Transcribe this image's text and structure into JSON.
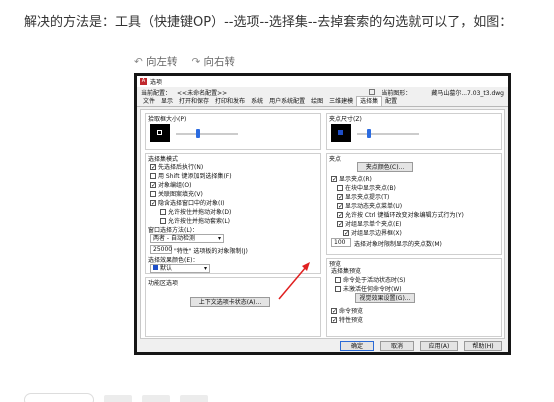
{
  "intro_text": "解决的方法是：工具（快捷键OP）--选项--选择集--去掉套索的勾选就可以了，如图：",
  "toolbar": {
    "rotate_left": "向左转",
    "rotate_right": "向右转"
  },
  "dialog": {
    "title": "选项",
    "profile_label": "当前配置：",
    "profile_value": "<<未命名配置>>",
    "drawing_label": "当前图形：",
    "drawing_value": "藏马山墓尔...7.03_t3.dwg",
    "tabs": [
      "文件",
      "显示",
      "打开和保存",
      "打印和发布",
      "系统",
      "用户系统配置",
      "绘图",
      "三维建模",
      "选择集",
      "配置"
    ],
    "active_tab": "选择集",
    "left": {
      "pickbox_label": "拾取框大小(P)",
      "mode_label": "选择集模式",
      "options": [
        {
          "label": "先选择后执行(N)",
          "checked": true
        },
        {
          "label": "用 Shift 键添加到选择集(F)",
          "checked": false
        },
        {
          "label": "对象编组(O)",
          "checked": true
        },
        {
          "label": "关联图案填充(V)",
          "checked": false
        },
        {
          "label": "隐含选择窗口中的对象(I)",
          "checked": true
        },
        {
          "label": "允许按住并拖动对象(D)",
          "checked": false
        },
        {
          "label": "允许按住并拖动套索(L)",
          "checked": false
        }
      ],
      "window_method_label": "窗口选择方法(L)：",
      "window_method_value": "两者 - 自动检测",
      "limit_value": "25000",
      "limit_label": "\"特性\" 选项板的对象限制(J)",
      "effect_label": "选择效果颜色(E)：",
      "effect_value": "默认",
      "ribbon_label": "功能区选项",
      "ribbon_button": "上下文选项卡状态(A)..."
    },
    "right": {
      "gripsize_label": "夹点尺寸(Z)",
      "grips_label": "夹点",
      "grip_color_button": "夹点颜色(C)...",
      "grip_options": [
        {
          "label": "显示夹点(R)",
          "checked": true
        },
        {
          "label": "在块中显示夹点(B)",
          "checked": false
        },
        {
          "label": "显示夹点提示(T)",
          "checked": true
        },
        {
          "label": "显示动态夹点菜单(U)",
          "checked": true
        },
        {
          "label": "允许按 Ctrl 键循环改变对象编辑方式行为(Y)",
          "checked": true
        },
        {
          "label": "对组显示单个夹点(E)",
          "checked": true
        },
        {
          "label": "对组显示边界框(X)",
          "checked": true
        }
      ],
      "grip_limit_value": "100",
      "grip_limit_label": "选择对象时限制显示的夹点数(M)",
      "preview_label": "预览",
      "preview_group_label": "选择集预览",
      "preview_options": [
        {
          "label": "命令处于活动状态时(S)",
          "checked": false
        },
        {
          "label": "未激活任何命令时(W)",
          "checked": false
        }
      ],
      "visual_effect_button": "视觉效果设置(G)...",
      "cmd_preview": {
        "label": "命令预览",
        "checked": true
      },
      "prop_preview": {
        "label": "特性预览",
        "checked": true
      }
    },
    "buttons": {
      "ok": "确定",
      "cancel": "取消",
      "apply": "应用(A)",
      "help": "帮助(H)"
    }
  }
}
